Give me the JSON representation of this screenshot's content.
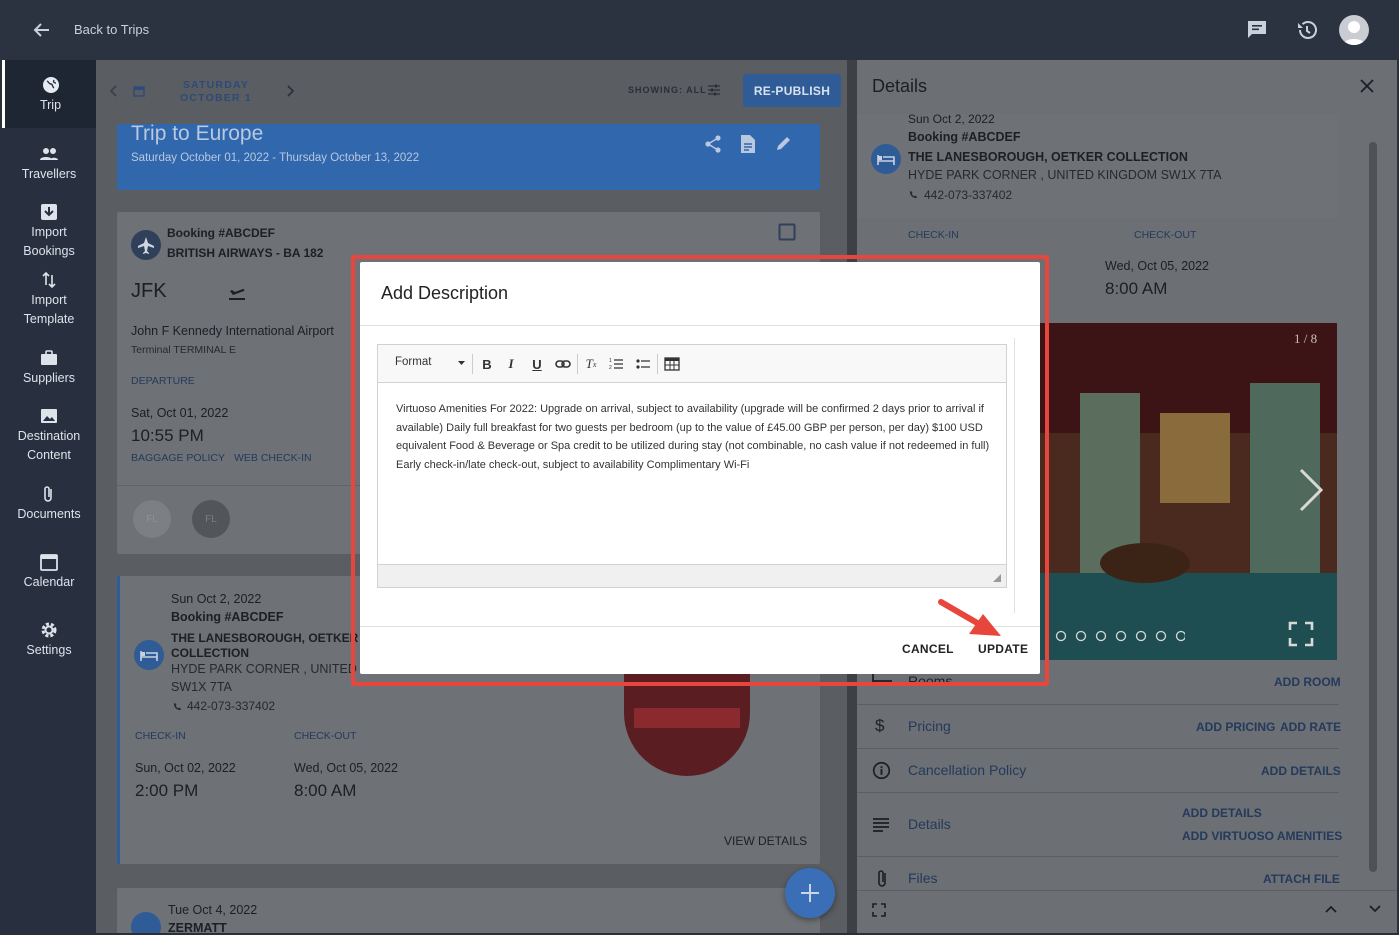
{
  "topbar": {
    "back_label": "Back to Trips"
  },
  "sidebar": {
    "items": [
      {
        "label": "Trip"
      },
      {
        "label": "Travellers"
      },
      {
        "label": "Import Bookings"
      },
      {
        "label": "Import Template"
      },
      {
        "label": "Suppliers"
      },
      {
        "label": "Destination Content"
      },
      {
        "label": "Documents"
      },
      {
        "label": "Calendar"
      },
      {
        "label": "Settings"
      }
    ]
  },
  "datebar": {
    "weekday": "SATURDAY",
    "date": "OCTOBER 1",
    "showing": "SHOWING: ALL",
    "republish": "RE-PUBLISH"
  },
  "trip": {
    "title": "Trip to Europe",
    "dates": "Saturday October 01, 2022 - Thursday October 13, 2022"
  },
  "flight": {
    "booking": "Booking #ABCDEF",
    "airline": "BRITISH AIRWAYS - BA 182",
    "code": "JFK",
    "airport": "John F Kennedy International Airport",
    "terminal": "Terminal TERMINAL E",
    "departure_label": "DEPARTURE",
    "date": "Sat, Oct 01, 2022",
    "time": "10:55 PM",
    "baggage": "BAGGAGE POLICY",
    "webcheckin": "WEB CHECK-IN",
    "chip1": "FL",
    "chip2": "FL"
  },
  "hotel": {
    "date": "Sun Oct 2, 2022",
    "booking": "Booking #ABCDEF",
    "name_line1": "THE LANESBOROUGH, OETKER",
    "name_line2": "COLLECTION",
    "addr_line1": "HYDE PARK CORNER , UNITED K",
    "addr_line2": "SW1X 7TA",
    "phone": "442-073-337402",
    "checkin_label": "CHECK-IN",
    "checkout_label": "CHECK-OUT",
    "checkin_date": "Sun, Oct 02, 2022",
    "checkin_time": "2:00 PM",
    "checkout_date": "Wed, Oct 05, 2022",
    "checkout_time": "8:00 AM",
    "view_details": "VIEW DETAILS"
  },
  "next": {
    "date": "Tue Oct 4, 2022",
    "name": "ZERMATT"
  },
  "details": {
    "title": "Details",
    "date": "Sun Oct 2, 2022",
    "booking": "Booking #ABCDEF",
    "name": "THE LANESBOROUGH, OETKER COLLECTION",
    "address": "HYDE PARK CORNER , UNITED KINGDOM SW1X 7TA",
    "phone": "442-073-337402",
    "checkin_label": "CHECK-IN",
    "checkout_label": "CHECK-OUT",
    "checkout_date": "Wed, Oct 05, 2022",
    "checkout_time": "8:00 AM",
    "photo_counter": "1 / 8",
    "rooms_label": "Rooms",
    "add_room": "ADD ROOM",
    "pricing": "Pricing",
    "add_pricing": "ADD PRICING",
    "add_rate": "ADD RATE",
    "cancellation": "Cancellation Policy",
    "add_details": "ADD DETAILS",
    "details_label": "Details",
    "add_details2": "ADD DETAILS",
    "add_virtuoso": "ADD VIRTUOSO AMENITIES",
    "files": "Files",
    "attach_file": "ATTACH FILE"
  },
  "dialog": {
    "title": "Add Description",
    "format": "Format",
    "body": "Virtuoso Amenities For 2022: Upgrade on arrival, subject to availability (upgrade will be confirmed 2 days prior to arrival if available) Daily full breakfast for two guests per bedroom (up to the value of £45.00 GBP per person, per day) $100 USD equivalent Food & Beverage or Spa credit to be utilized during stay (not combinable, no cash value if not redeemed in full) Early check-in/late check-out, subject to availability Complimentary Wi-Fi",
    "cancel": "CANCEL",
    "update": "UPDATE"
  },
  "colors": {
    "accent": "#3067ad",
    "highlight": "#e8463c",
    "sidebar": "#283040"
  }
}
